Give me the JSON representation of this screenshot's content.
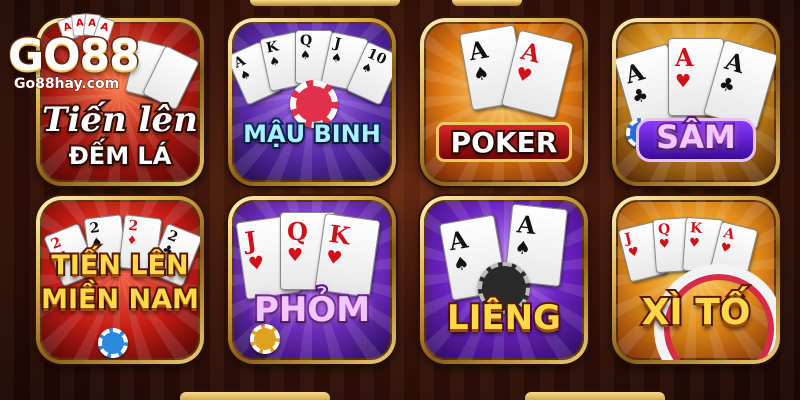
{
  "logo": {
    "brand": "GO88",
    "site": "Go88hay.com",
    "cards": [
      "A",
      "A",
      "A",
      "A"
    ]
  },
  "games": [
    {
      "id": "tien-len-dem-la",
      "title_line1": "Tiến lên",
      "title_line2": "ĐẾM LÁ"
    },
    {
      "id": "mau-binh",
      "title_line1": "MẬU BINH",
      "cards": [
        "A",
        "K",
        "Q",
        "J",
        "10"
      ]
    },
    {
      "id": "poker",
      "title_line1": "POKER",
      "cards": [
        "A",
        "A"
      ]
    },
    {
      "id": "sam",
      "title_line1": "SÂM",
      "cards": [
        "A",
        "A",
        "A"
      ]
    },
    {
      "id": "tien-len-mien-nam",
      "title_line1": "TIẾN LÊN",
      "title_line2": "MIỀN NAM",
      "cards": [
        "2",
        "2",
        "2",
        "2"
      ]
    },
    {
      "id": "phom",
      "title_line1": "PHỎM",
      "cards": [
        "J",
        "Q",
        "K"
      ]
    },
    {
      "id": "lieng",
      "title_line1": "LIÊNG",
      "cards": [
        "A",
        "A"
      ]
    },
    {
      "id": "xi-to",
      "title_line1": "XÌ TỐ",
      "cards": [
        "J",
        "Q",
        "K",
        "A"
      ]
    }
  ],
  "colors": {
    "frame_gold": "#e5b24a",
    "background": "#2a0c08"
  }
}
